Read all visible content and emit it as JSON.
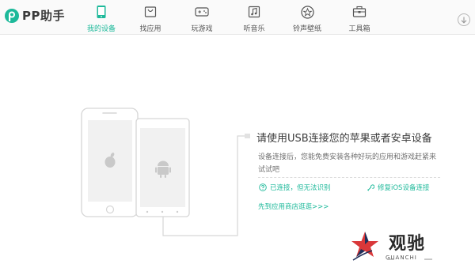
{
  "app": {
    "name": "PP助手"
  },
  "nav": [
    {
      "label": "我的设备",
      "icon": "phone-icon",
      "active": true
    },
    {
      "label": "找应用",
      "icon": "shopping-bag-icon",
      "active": false
    },
    {
      "label": "玩游戏",
      "icon": "gamepad-icon",
      "active": false
    },
    {
      "label": "听音乐",
      "icon": "music-icon",
      "active": false
    },
    {
      "label": "铃声壁纸",
      "icon": "star-icon",
      "active": false
    },
    {
      "label": "工具箱",
      "icon": "toolbox-icon",
      "active": false
    }
  ],
  "main": {
    "title": "请使用USB连接您的苹果或者安卓设备",
    "description": "设备连接后，您能免费安装各种好玩的应用和游戏赶紧来试试吧",
    "links": {
      "connected_unrecognized": "已连接，但无法识别",
      "repair_ios": "修复iOS设备连接",
      "go_store": "先到应用商店逛逛>>>"
    }
  },
  "watermark": {
    "text": "观驰",
    "sub": "GUANCHI"
  },
  "colors": {
    "accent": "#1db99a",
    "line": "#d6d6d6"
  }
}
